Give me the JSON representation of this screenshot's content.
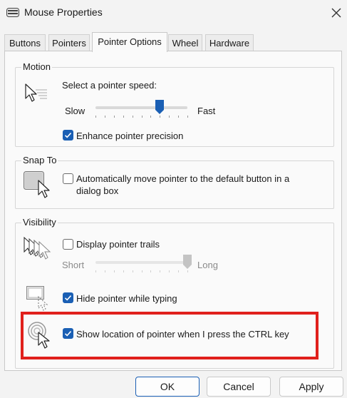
{
  "window": {
    "title": "Mouse Properties"
  },
  "tabs": [
    {
      "label": "Buttons"
    },
    {
      "label": "Pointers"
    },
    {
      "label": "Pointer Options"
    },
    {
      "label": "Wheel"
    },
    {
      "label": "Hardware"
    }
  ],
  "active_tab": "Pointer Options",
  "motion": {
    "legend": "Motion",
    "speed_label": "Select a pointer speed:",
    "slow_label": "Slow",
    "fast_label": "Fast",
    "speed_level": 0.7,
    "enhance_label": "Enhance pointer precision",
    "enhance_checked": true
  },
  "snap_to": {
    "legend": "Snap To",
    "auto_move_label_line1": "Automatically move pointer to the default button in a",
    "auto_move_label_line2": "dialog box",
    "auto_move_checked": false
  },
  "visibility": {
    "legend": "Visibility",
    "trails_label": "Display pointer trails",
    "trails_checked": false,
    "short_label": "Short",
    "long_label": "Long",
    "trail_length_level": 1.0,
    "hide_typing_label": "Hide pointer while typing",
    "hide_typing_checked": true,
    "show_location_label": "Show location of pointer when I press the CTRL key",
    "show_location_checked": true
  },
  "buttons": {
    "ok": "OK",
    "cancel": "Cancel",
    "apply": "Apply"
  },
  "colors": {
    "accent": "#1a5fb4",
    "highlight": "#e0201c",
    "background": "#f3f3f3"
  }
}
